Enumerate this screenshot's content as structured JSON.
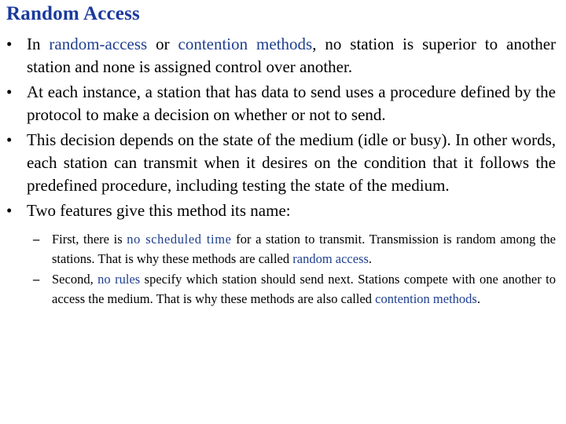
{
  "title": "Random Access",
  "colors": {
    "title": "#1a3a9c",
    "highlight": "#1f3f8f",
    "text": "#000000",
    "background": "#ffffff"
  },
  "bullets": [
    {
      "parts": [
        {
          "text": "In ",
          "highlight": false
        },
        {
          "text": "random-access",
          "highlight": true
        },
        {
          "text": " or ",
          "highlight": false
        },
        {
          "text": "contention methods",
          "highlight": true
        },
        {
          "text": ", no station is superior to another station and none is assigned control over another.",
          "highlight": false
        }
      ]
    },
    {
      "parts": [
        {
          "text": "At each instance, a station that has data to send uses a procedure defined by the protocol to make a decision on whether or not to send.",
          "highlight": false
        }
      ]
    },
    {
      "parts": [
        {
          "text": "This decision depends on the state of the medium (idle or busy). In other words, each station can transmit when it desires on the condition that it follows the predefined procedure, including testing the state of the medium.",
          "highlight": false
        }
      ]
    },
    {
      "parts": [
        {
          "text": "Two features give this method its name:",
          "highlight": false
        }
      ]
    }
  ],
  "sub_bullets": [
    {
      "parts": [
        {
          "text": "First, there is ",
          "highlight": false
        },
        {
          "text": "no scheduled time",
          "highlight": true
        },
        {
          "text": " for a station to transmit. Transmission is random among the stations. That is why these methods are called ",
          "highlight": false
        },
        {
          "text": "random access",
          "highlight": true
        },
        {
          "text": ".",
          "highlight": false
        }
      ]
    },
    {
      "parts": [
        {
          "text": "Second, ",
          "highlight": false
        },
        {
          "text": "no rules",
          "highlight": true
        },
        {
          "text": " specify which station should send next. Stations compete with one another to access the medium. That is why these methods are also called ",
          "highlight": false
        },
        {
          "text": "contention methods",
          "highlight": true
        },
        {
          "text": ".",
          "highlight": false
        }
      ]
    }
  ]
}
